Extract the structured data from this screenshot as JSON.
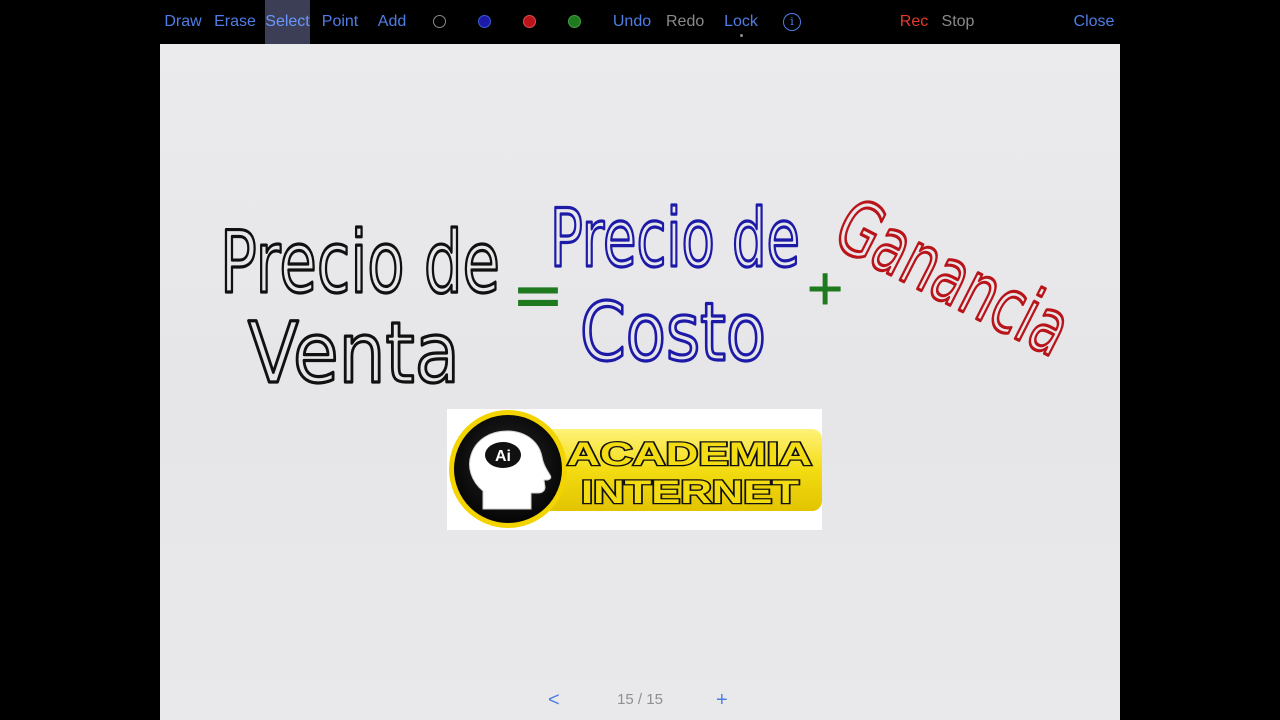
{
  "toolbar": {
    "draw": "Draw",
    "erase": "Erase",
    "select": "Select",
    "point": "Point",
    "add": "Add",
    "undo": "Undo",
    "redo": "Redo",
    "lock": "Lock",
    "info": "i",
    "rec": "Rec",
    "stop": "Stop",
    "close": "Close"
  },
  "colors": {
    "black": "#111111",
    "blue": "#1d1aa8",
    "red": "#b8141a",
    "green": "#1f7a1f",
    "accent": "#4f7de6"
  },
  "board": {
    "left_top": "Precio de",
    "left_bottom": "Venta",
    "equals": "=",
    "mid_top": "Precio de",
    "mid_bottom": "Costo",
    "plus": "+",
    "right": "Ganancia"
  },
  "logo": {
    "badge": "Ai",
    "line1": "ACADEMIA",
    "line2": "INTERNET"
  },
  "pager": {
    "prev": "<",
    "count": "15 / 15",
    "add": "+"
  }
}
